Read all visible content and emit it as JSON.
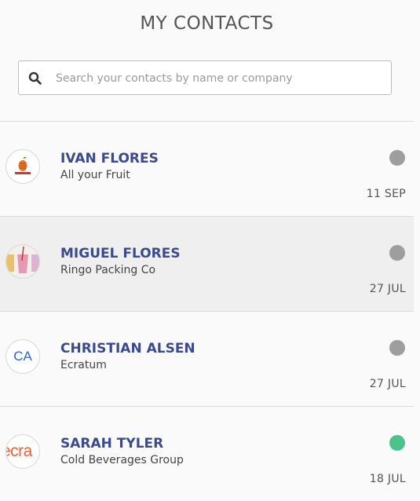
{
  "header": {
    "title": "MY CONTACTS"
  },
  "search": {
    "placeholder": "Search your contacts by name or company",
    "value": ""
  },
  "contacts": [
    {
      "name": "IVAN FLORES",
      "company": "All your Fruit",
      "date": "11 SEP",
      "status_color": "#9e9e9e",
      "avatar": "fruit-logo",
      "avatar_text": ""
    },
    {
      "name": "MIGUEL FLORES",
      "company": "Ringo Packing Co",
      "date": "27 JUL",
      "status_color": "#9e9e9e",
      "avatar": "smoothie-logo",
      "avatar_text": ""
    },
    {
      "name": "CHRISTIAN ALSEN",
      "company": "Ecratum",
      "date": "27 JUL",
      "status_color": "#9e9e9e",
      "avatar": "initials",
      "avatar_text": "CA"
    },
    {
      "name": "SARAH TYLER",
      "company": "Cold Beverages Group",
      "date": "18 JUL",
      "status_color": "#4cc38a",
      "avatar": "ecratum-logo",
      "avatar_text": "ecra"
    }
  ]
}
